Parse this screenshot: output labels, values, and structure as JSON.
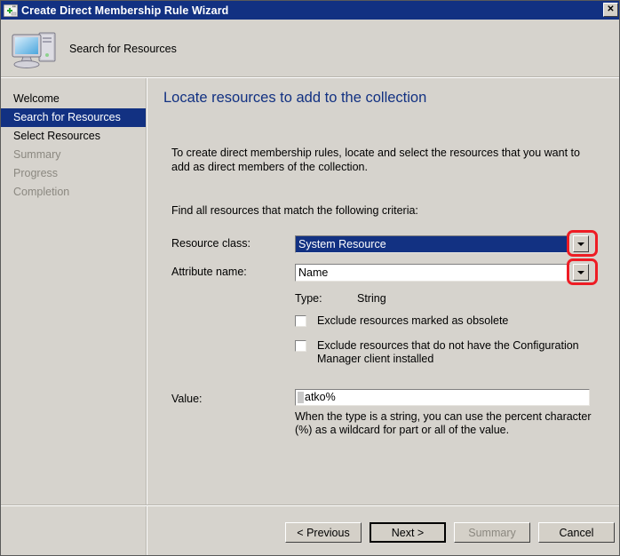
{
  "window": {
    "title": "Create Direct Membership Rule Wizard",
    "icon": "wizard-window-icon",
    "close_label": "✕"
  },
  "header": {
    "title": "Search for Resources",
    "icon": "computer-icon"
  },
  "sidebar": {
    "items": [
      {
        "label": "Welcome",
        "state": "normal"
      },
      {
        "label": "Search for Resources",
        "state": "active"
      },
      {
        "label": "Select Resources",
        "state": "normal"
      },
      {
        "label": "Summary",
        "state": "disabled"
      },
      {
        "label": "Progress",
        "state": "disabled"
      },
      {
        "label": "Completion",
        "state": "disabled"
      }
    ]
  },
  "main": {
    "heading": "Locate resources to add to the collection",
    "intro": "To create direct membership rules, locate and select the resources that you want to add as direct members of the collection.",
    "criteria_prompt": "Find all resources that match the following criteria:",
    "fields": {
      "resource_class": {
        "label": "Resource class:",
        "value": "System Resource",
        "dropdown_icon": "chevron-down-icon"
      },
      "attribute_name": {
        "label": "Attribute name:",
        "value": "Name",
        "dropdown_icon": "chevron-down-icon"
      },
      "type": {
        "label": "Type:",
        "value": "String"
      },
      "value": {
        "label": "Value:",
        "value": "atko%",
        "hint": "When the type is a string, you can use the percent character (%) as a wildcard for part or all of the value."
      }
    },
    "checkboxes": [
      {
        "label": "Exclude resources marked as obsolete",
        "checked": false
      },
      {
        "label": "Exclude resources that do not have the Configuration Manager client installed",
        "checked": false
      }
    ]
  },
  "footer": {
    "buttons": [
      {
        "label": "< Previous",
        "state": "normal"
      },
      {
        "label": "Next >",
        "state": "default"
      },
      {
        "label": "Summary",
        "state": "disabled"
      },
      {
        "label": "Cancel",
        "state": "normal"
      }
    ]
  },
  "colors": {
    "titlebar": "#123182",
    "accent": "#123182",
    "dialog_face": "#d6d3cd",
    "annotation": "#ee1c24"
  }
}
